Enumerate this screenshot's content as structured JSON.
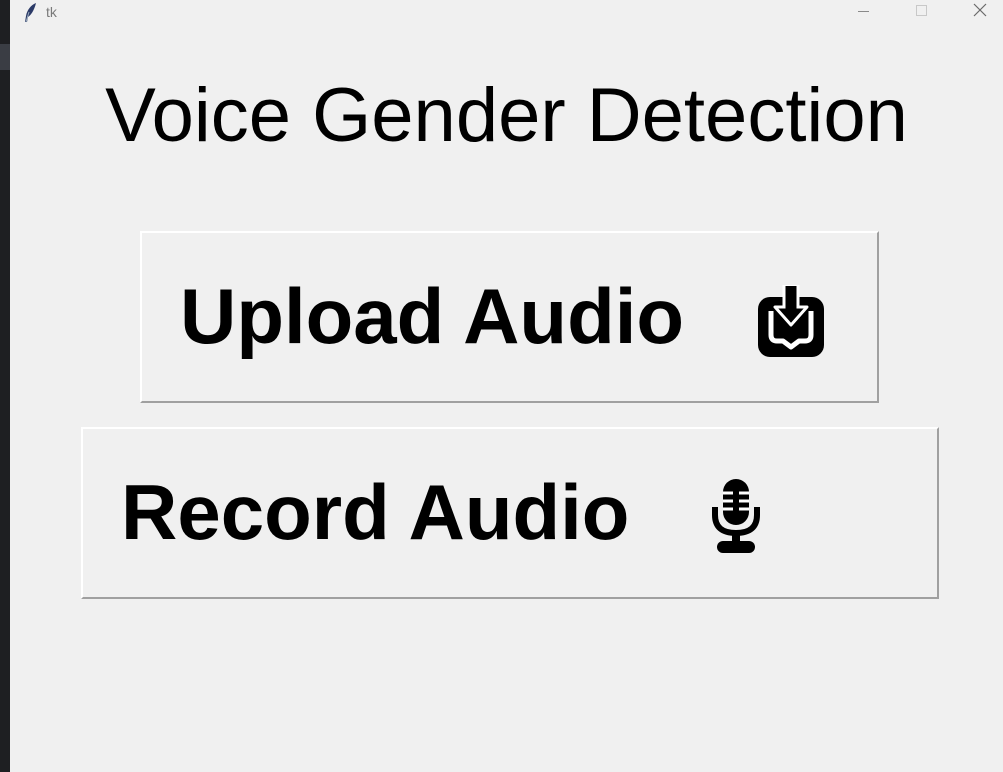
{
  "window": {
    "title": "tk",
    "heading": "Voice Gender Detection"
  },
  "buttons": {
    "upload_label": "Upload Audio",
    "upload_icon": "upload-icon",
    "record_label": "Record Audio",
    "record_icon": "microphone-icon"
  },
  "colors": {
    "background": "#f0f0f0",
    "text": "#000000",
    "title_text": "#7a7a7a"
  }
}
